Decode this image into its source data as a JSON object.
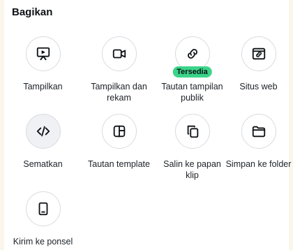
{
  "panel": {
    "title": "Bagikan",
    "items": [
      {
        "label": "Tampilkan",
        "icon": "present-icon"
      },
      {
        "label": "Tampilkan dan rekam",
        "icon": "video-camera-icon"
      },
      {
        "label": "Tautan tampilan publik",
        "icon": "link-icon",
        "badge": "Tersedia"
      },
      {
        "label": "Situs web",
        "icon": "website-icon"
      },
      {
        "label": "Sematkan",
        "icon": "code-icon"
      },
      {
        "label": "Tautan template",
        "icon": "template-icon"
      },
      {
        "label": "Salin ke papan klip",
        "icon": "copy-icon"
      },
      {
        "label": "Simpan ke folder",
        "icon": "folder-icon"
      },
      {
        "label": "Kirim ke ponsel",
        "icon": "phone-icon"
      }
    ]
  },
  "colors": {
    "badge": "#3bd489",
    "text": "#0d1216"
  }
}
